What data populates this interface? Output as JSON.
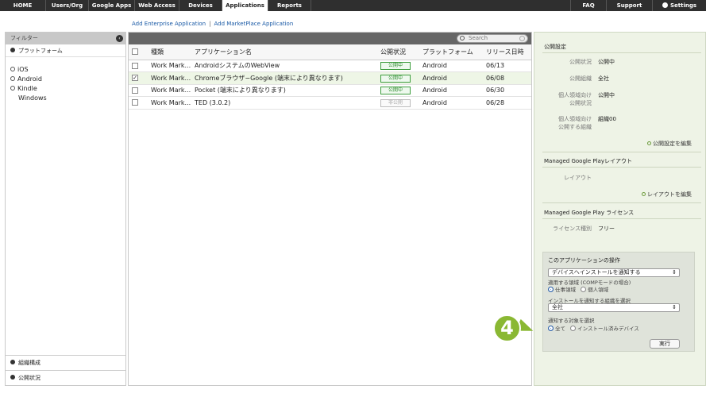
{
  "nav": {
    "home": "HOME",
    "users": "Users/Org",
    "google_apps": "Google Apps",
    "web_access": "Web Access",
    "devices": "Devices",
    "applications": "Applications",
    "reports": "Reports",
    "faq": "FAQ",
    "support": "Support",
    "settings": "Settings"
  },
  "links": {
    "add_enterprise": "Add Enterprise Application",
    "separator": "|",
    "add_marketplace": "Add MarketPlace Application"
  },
  "sidebar": {
    "title": "フィルター",
    "platform_header": "プラットフォーム",
    "platforms": [
      "iOS",
      "Android",
      "Kindle",
      "Windows"
    ],
    "bottom1": "組織構成",
    "bottom2": "公開状況"
  },
  "table": {
    "search_placeholder": "Search",
    "headers": {
      "kind": "種類",
      "name": "アプリケーション名",
      "status": "公開状況",
      "platform": "プラットフォーム",
      "release": "リリース日時"
    },
    "rows": [
      {
        "kind": "Work Mark...",
        "name": "AndroidシステムのWebView",
        "status": "公開中",
        "platform": "Android",
        "release": "06/13",
        "checked": false
      },
      {
        "kind": "Work Mark...",
        "name": "Chromeブラウザ−Google (端末により異なります)",
        "status": "公開中",
        "platform": "Android",
        "release": "06/08",
        "checked": true
      },
      {
        "kind": "Work Mark...",
        "name": "Pocket (端末により異なります)",
        "status": "公開中",
        "platform": "Android",
        "release": "06/30",
        "checked": false
      },
      {
        "kind": "Work Mark...",
        "name": "TED (3.0.2)",
        "status": "非公開",
        "platform": "Android",
        "release": "06/28",
        "checked": false
      }
    ]
  },
  "right": {
    "publish_title": "公開設定",
    "label_status": "公開状況",
    "value_status": "公開中",
    "label_org": "公開組織",
    "value_org": "全社",
    "label_personal_status_1": "個人領域向け",
    "label_personal_status_2": "公開状況",
    "value_personal_status": "公開中",
    "label_personal_org_1": "個人領域向け",
    "label_personal_org_2": "公開する組織",
    "value_personal_org": "組織00",
    "edit_publish": "公開設定を編集",
    "layout_title": "Managed Google Playレイアウト",
    "label_layout": "レイアウト",
    "edit_layout": "レイアウトを編集",
    "license_title": "Managed Google Play ライセンス",
    "label_license": "ライセンス種別",
    "value_license": "フリー",
    "ops_title": "このアプリケーションの操作",
    "ops_action": "デバイスへインストールを通知する",
    "ops_area_label": "適用する領域 (COMPモードの場合)",
    "ops_area_work": "仕事領域",
    "ops_area_personal": "個人領域",
    "ops_org_label": "インストールを通知する組織を選択",
    "ops_org_value": "全社",
    "ops_target_label": "通知する対象を選択",
    "ops_target_all": "全て",
    "ops_target_installed": "インストール済みデバイス",
    "run_button": "実行"
  },
  "callout": "4"
}
